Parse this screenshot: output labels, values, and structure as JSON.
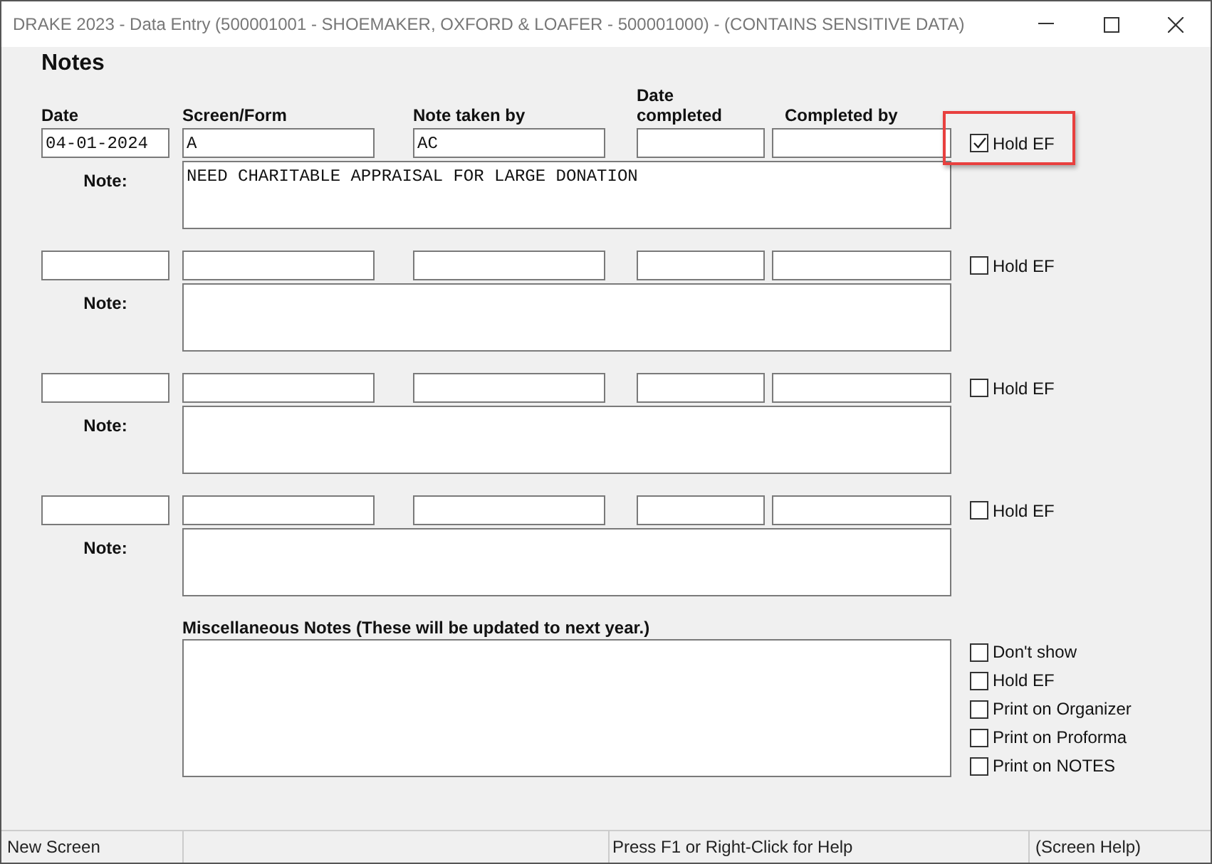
{
  "window": {
    "title": "DRAKE 2023 - Data Entry (500001001 - SHOEMAKER, OXFORD & LOAFER - 500001000) - (CONTAINS SENSITIVE DATA)"
  },
  "heading": "Notes",
  "columns": [
    "Date",
    "Screen/Form",
    "Note taken by",
    "Date completed",
    "Completed by"
  ],
  "entries": [
    {
      "date": "04-01-2024",
      "screen_form": "A",
      "note_taken_by": "AC",
      "hold_ef": {
        "label": "Hold EF",
        "checked": true
      },
      "highlighted": true,
      "note_label": "Note:",
      "note": "NEED CHARITABLE APPRAISAL FOR LARGE DONATION"
    },
    {
      "hold_ef": {
        "label": "Hold EF",
        "checked": false
      },
      "highlighted": false,
      "note_label": "Note:"
    },
    {
      "hold_ef": {
        "label": "Hold EF",
        "checked": false
      },
      "highlighted": false,
      "note_label": "Note:"
    },
    {
      "hold_ef": {
        "label": "Hold EF",
        "checked": false
      },
      "highlighted": false,
      "note_label": "Note:"
    }
  ],
  "misc": {
    "label": "Miscellaneous Notes (These will be updated to next year.)",
    "options": [
      {
        "label": "Don't show",
        "checked": false
      },
      {
        "label": "Hold EF",
        "checked": false
      },
      {
        "label": "Print on Organizer",
        "checked": false
      },
      {
        "label": "Print on Proforma",
        "checked": false
      },
      {
        "label": "Print on NOTES",
        "checked": false
      }
    ]
  },
  "status_bar": {
    "left": "New Screen",
    "help": "Press F1 or Right-Click for Help",
    "screen_help": "(Screen Help)"
  }
}
